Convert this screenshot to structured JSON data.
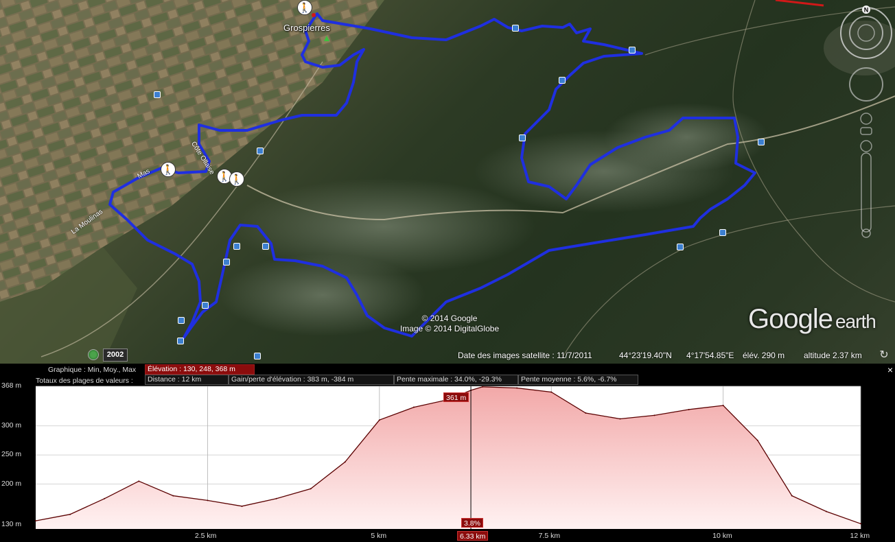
{
  "map": {
    "town": "Grospierres",
    "road_labels": [
      "Mas",
      "Côte Ollaise",
      "La Moulinas"
    ],
    "copyright_google": "© 2014 Google",
    "copyright_imagery": "Image © 2014 DigitalGlobe",
    "logo_google": "Google",
    "logo_earth": "earth",
    "compass_north": "N",
    "historical_year": "2002",
    "status": {
      "imagery_date": "Date des images satellite : 11/7/2011",
      "latitude": "44°23'19.40\"N",
      "longitude": "4°17'54.85\"E",
      "elevation": "élév.   290 m",
      "altitude": "altitude    2.37 km"
    },
    "colors": {
      "track": "#1f2fe0"
    }
  },
  "profile": {
    "close": "×",
    "row1_label": "Graphique : Min, Moy., Max",
    "row1_field": "Élévation : 130, 248, 368 m",
    "row2_label": "Totaux des plages de valeurs :",
    "row2_fields": [
      "Distance : 12 km",
      "Gain/perte d'élévation : 383 m, -384 m",
      "Pente maximale : 34.0%, -29.3%",
      "Pente moyenne : 5.6%, -6.7%"
    ],
    "y_labels": [
      "368 m",
      "300 m",
      "250 m",
      "200 m",
      "130 m"
    ],
    "x_labels": [
      "2.5 km",
      "5 km",
      "7.5 km",
      "10 km",
      "12 km"
    ],
    "cursor": {
      "elevation_tag": "361 m",
      "slope_tag": "3.8%",
      "distance_tag": "6.33 km"
    },
    "colors": {
      "line": "#5a0000",
      "fill_top": "#f2a8a8",
      "fill_bottom": "#fff2f2",
      "tag": "#8b0c0c"
    }
  },
  "chart_data": {
    "type": "area",
    "title": "",
    "xlabel": "",
    "ylabel": "",
    "xlim": [
      0,
      12
    ],
    "ylim": [
      130,
      368
    ],
    "x": [
      0,
      0.5,
      1.0,
      1.5,
      2.0,
      2.5,
      3.0,
      3.5,
      4.0,
      4.5,
      5.0,
      5.5,
      6.0,
      6.33,
      6.5,
      7.0,
      7.5,
      8.0,
      8.5,
      9.0,
      9.5,
      10.0,
      10.5,
      11.0,
      11.5,
      12.0
    ],
    "series": [
      {
        "values": [
          137,
          148,
          175,
          205,
          180,
          172,
          162,
          175,
          192,
          238,
          310,
          332,
          345,
          361,
          367,
          365,
          358,
          322,
          312,
          318,
          328,
          335,
          275,
          180,
          153,
          132
        ]
      }
    ],
    "grid": true
  }
}
